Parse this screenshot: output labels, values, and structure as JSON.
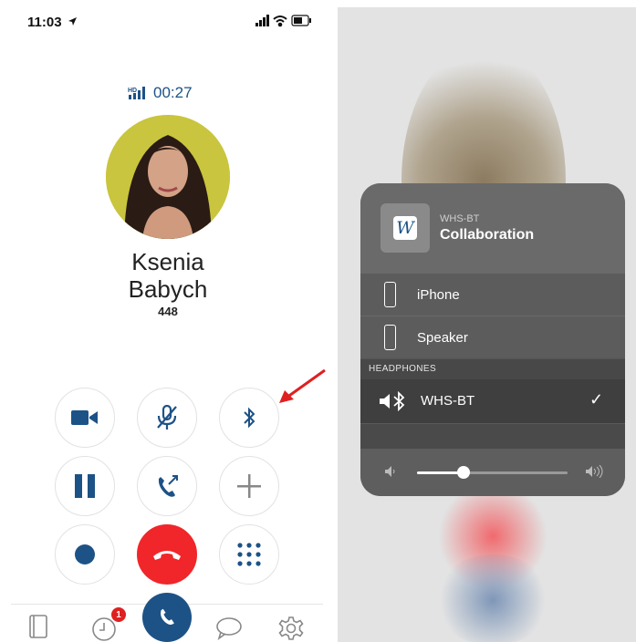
{
  "status_bar": {
    "time": "11:03"
  },
  "call": {
    "hd_label": "HD",
    "timer": "00:27",
    "contact_first": "Ksenia",
    "contact_last": "Babych",
    "extension": "448"
  },
  "controls": [
    {
      "name": "video",
      "icon": "video-camera-icon"
    },
    {
      "name": "mute",
      "icon": "microphone-off-icon"
    },
    {
      "name": "bluetooth",
      "icon": "bluetooth-icon"
    },
    {
      "name": "hold",
      "icon": "pause-icon"
    },
    {
      "name": "transfer",
      "icon": "call-transfer-icon"
    },
    {
      "name": "add-call",
      "icon": "plus-icon"
    },
    {
      "name": "record",
      "icon": "record-icon"
    },
    {
      "name": "end-call",
      "icon": "hang-up-icon"
    },
    {
      "name": "keypad",
      "icon": "keypad-icon"
    }
  ],
  "tab_bar": {
    "recents_badge": "1",
    "tabs": [
      "contacts-book-icon",
      "recents-clock-icon",
      "call-icon",
      "chat-bubble-icon",
      "settings-gear-icon"
    ]
  },
  "audio_panel": {
    "source_device": "WHS-BT",
    "source_app": "Collaboration",
    "app_icon_letter": "W",
    "outputs": [
      "iPhone",
      "Speaker"
    ],
    "section_header": "HEADPHONES",
    "headphones": "WHS-BT",
    "selected": "WHS-BT",
    "volume_fraction": 0.31
  },
  "colors": {
    "brand": "#1d5286",
    "end_call": "#f0262a",
    "badge": "#e02020",
    "annotation_arrow": "#e02020"
  }
}
